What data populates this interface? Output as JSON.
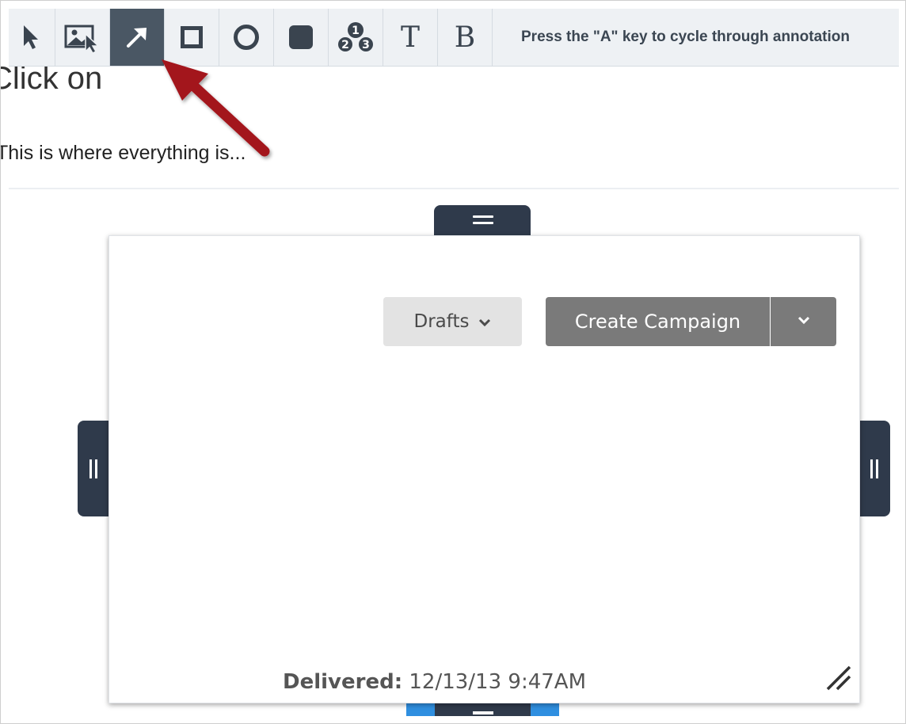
{
  "toolbar": {
    "tools": [
      {
        "name": "select",
        "icon": "cursor-arrow-icon"
      },
      {
        "name": "image-select",
        "icon": "image-select-icon"
      },
      {
        "name": "arrow",
        "icon": "arrow-tool-icon",
        "active": true
      },
      {
        "name": "rectangle",
        "icon": "rectangle-tool-icon"
      },
      {
        "name": "ellipse",
        "icon": "ellipse-tool-icon"
      },
      {
        "name": "filled-rectangle",
        "icon": "filled-rectangle-tool-icon"
      },
      {
        "name": "numbered-steps",
        "icon": "numbered-steps-icon"
      },
      {
        "name": "text",
        "label": "T",
        "icon": "text-tool-icon"
      },
      {
        "name": "blur",
        "label": "B",
        "icon": "blur-tool-icon"
      }
    ],
    "hint": "Press the \"A\" key to cycle through annotation"
  },
  "background": {
    "heading": "Click on",
    "text": "This is where everything is..."
  },
  "panel": {
    "drafts_label": "Drafts",
    "create_label": "Create Campaign",
    "delivered_label": "Delivered:",
    "delivered_value": "12/13/13 9:47AM"
  },
  "colors": {
    "toolbar_bg": "#eef1f4",
    "active_tool": "#4a5764",
    "handle": "#2f3a4b",
    "handle_accent": "#2f8fe0",
    "annotation_arrow": "#a3141c",
    "drafts_bg": "#e3e3e3",
    "create_bg": "#7a7a7a"
  }
}
